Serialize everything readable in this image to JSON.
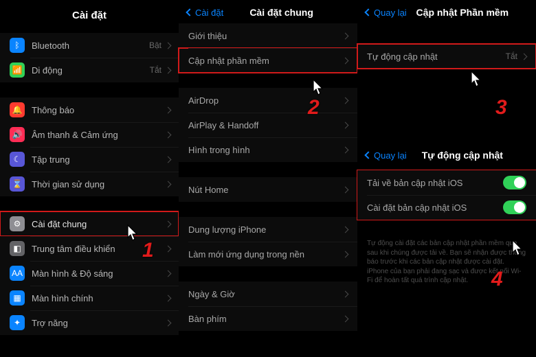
{
  "left": {
    "title": "Cài đặt",
    "groups": [
      [
        {
          "icon": "bluetooth-icon",
          "bg": "bg-blue",
          "label": "Bluetooth",
          "value": "Bật"
        },
        {
          "icon": "cellular-icon",
          "bg": "bg-green",
          "label": "Di động",
          "value": "Tắt"
        }
      ],
      [
        {
          "icon": "bell-icon",
          "bg": "bg-red",
          "label": "Thông báo"
        },
        {
          "icon": "sound-icon",
          "bg": "bg-redd",
          "label": "Âm thanh & Cảm ứng"
        },
        {
          "icon": "moon-icon",
          "bg": "bg-indigo",
          "label": "Tập trung"
        },
        {
          "icon": "hourglass-icon",
          "bg": "bg-indigo",
          "label": "Thời gian sử dụng"
        }
      ],
      [
        {
          "icon": "gear-icon",
          "bg": "bg-gray",
          "label": "Cài đặt chung",
          "hl": true
        },
        {
          "icon": "control-center-icon",
          "bg": "bg-gray2",
          "label": "Trung tâm điều khiển"
        },
        {
          "icon": "display-icon",
          "bg": "bg-blue",
          "label": "Màn hình & Độ sáng"
        },
        {
          "icon": "home-icon",
          "bg": "bg-blue",
          "label": "Màn hình chính"
        },
        {
          "icon": "accessibility-icon",
          "bg": "bg-blue",
          "label": "Trợ năng"
        }
      ]
    ]
  },
  "mid": {
    "back": "Cài đặt",
    "title": "Cài đặt chung",
    "groups": [
      [
        {
          "label": "Giới thiệu"
        },
        {
          "label": "Cập nhật phần mềm",
          "hl": true,
          "bright": true
        }
      ],
      [
        {
          "label": "AirDrop"
        },
        {
          "label": "AirPlay & Handoff"
        },
        {
          "label": "Hình trong hình"
        }
      ],
      [
        {
          "label": "Nút Home"
        }
      ],
      [
        {
          "label": "Dung lượng iPhone"
        },
        {
          "label": "Làm mới ứng dụng trong nền"
        }
      ],
      [
        {
          "label": "Ngày & Giờ"
        },
        {
          "label": "Bàn phím"
        }
      ]
    ]
  },
  "right_top": {
    "back": "Quay lại",
    "title": "Cập nhật Phần mềm",
    "row": {
      "label": "Tự động cập nhật",
      "value": "Tắt"
    }
  },
  "right_bottom": {
    "back": "Quay lại",
    "title": "Tự động cập nhật",
    "rows": [
      {
        "label": "Tải về bản cập nhật iOS",
        "toggle": true
      },
      {
        "label": "Cài đặt bản cập nhật iOS",
        "toggle": true
      }
    ],
    "footer": "Tự động cài đặt các bản cập nhật phần mềm qua sau khi chúng được tải về. Bạn sẽ nhận được thông báo trước khi các bản cập nhật được cài đặt. iPhone của bạn phải đang sạc và được kết nối Wi-Fi để hoàn tất quá trình cập nhật."
  },
  "steps": {
    "s1": "1",
    "s2": "2",
    "s3": "3",
    "s4": "4"
  }
}
